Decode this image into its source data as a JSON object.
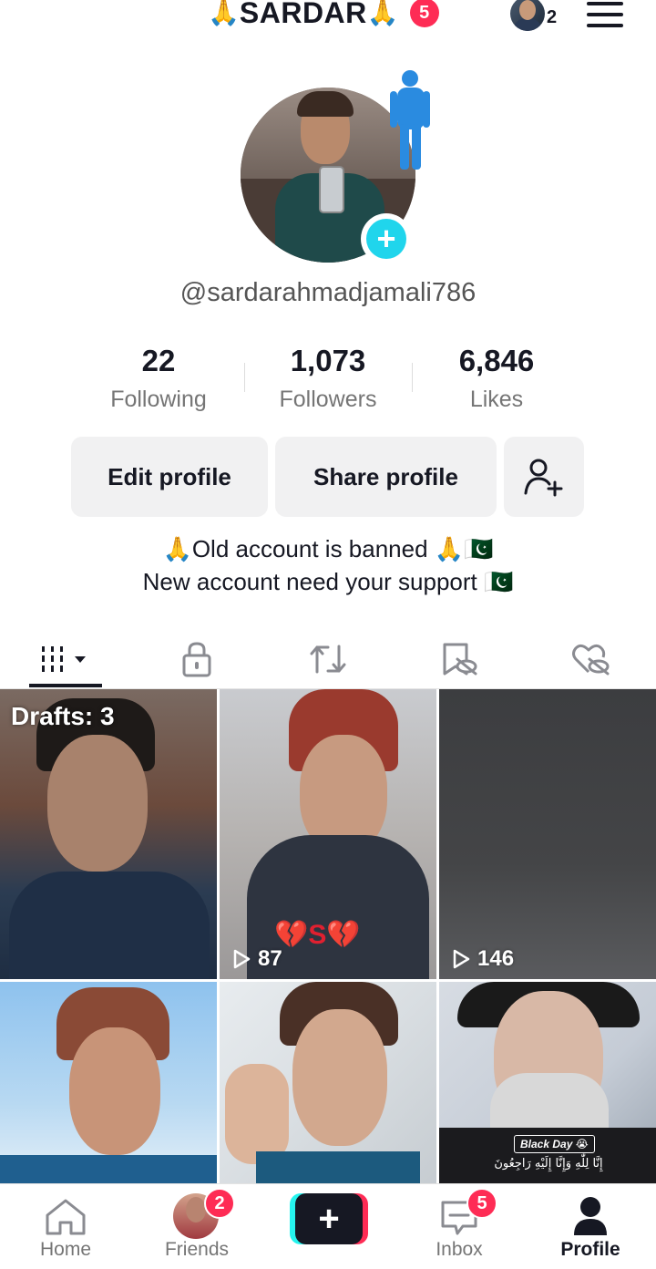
{
  "header": {
    "title_prefix_emoji": "🙏",
    "title": "SARDAR",
    "title_suffix_emoji": "🙏",
    "notification_count": "5",
    "switch_account_count": "2"
  },
  "profile": {
    "username": "@sardarahmadjamali786",
    "stats": [
      {
        "value": "22",
        "label": "Following"
      },
      {
        "value": "1,073",
        "label": "Followers"
      },
      {
        "value": "6,846",
        "label": "Likes"
      }
    ],
    "buttons": {
      "edit": "Edit profile",
      "share": "Share profile"
    },
    "bio_line1": "🙏Old account is banned 🙏🇵🇰",
    "bio_line2": "New account need your support 🇵🇰"
  },
  "tabs": [
    {
      "name": "videos",
      "icon": "grid-icon",
      "active": true
    },
    {
      "name": "private",
      "icon": "lock-icon"
    },
    {
      "name": "reposts",
      "icon": "repost-icon"
    },
    {
      "name": "favorites",
      "icon": "bookmark-icon"
    },
    {
      "name": "liked",
      "icon": "heart-icon"
    }
  ],
  "grid": {
    "drafts_label": "Drafts: 3",
    "tiles": [
      {
        "views": ""
      },
      {
        "views": "87",
        "overlay_text": "💔S💔"
      },
      {
        "views": "146"
      },
      {
        "views": ""
      },
      {
        "views": ""
      },
      {
        "views": "",
        "caption": "Black Day 😭",
        "arabic": "إِنَّا لِلّٰهِ وَإِنَّا إِلَيْهِ رَاجِعُونَ"
      }
    ]
  },
  "bottom_nav": {
    "home": "Home",
    "friends": "Friends",
    "friends_badge": "2",
    "inbox": "Inbox",
    "inbox_badge": "5",
    "profile": "Profile"
  },
  "colors": {
    "accent": "#fe2c55",
    "cyan": "#25f4ee",
    "add_button": "#20d5ec"
  }
}
